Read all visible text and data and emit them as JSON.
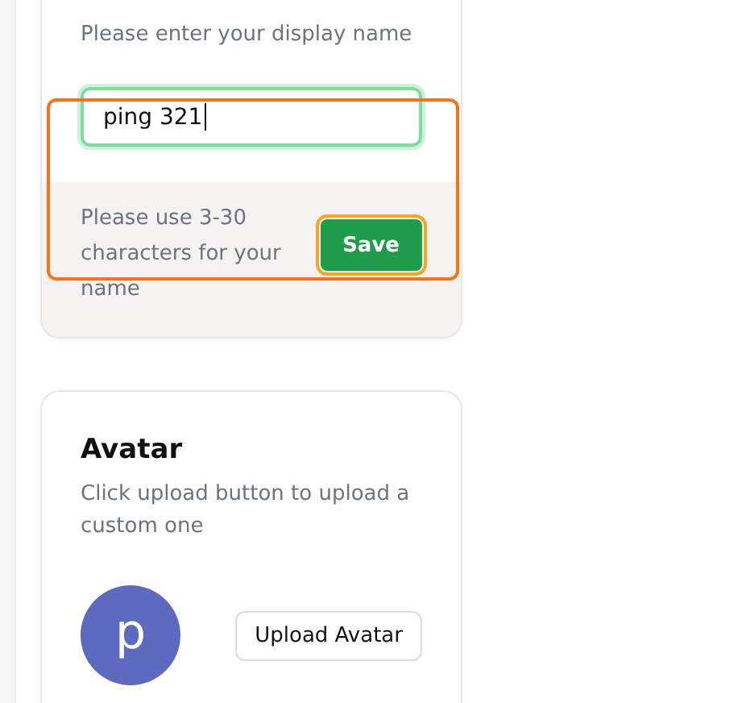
{
  "name_card": {
    "description": "Please enter your display name",
    "input": {
      "value": "ping 321",
      "focused": true
    },
    "hint": "Please use 3-30 characters for your name",
    "save_button": {
      "label": "Save",
      "highlighted": true
    },
    "highlighted": true
  },
  "avatar_card": {
    "title": "Avatar",
    "description": "Click upload button to upload a custom one",
    "avatar_letter": "p",
    "upload_button": "Upload Avatar"
  }
}
